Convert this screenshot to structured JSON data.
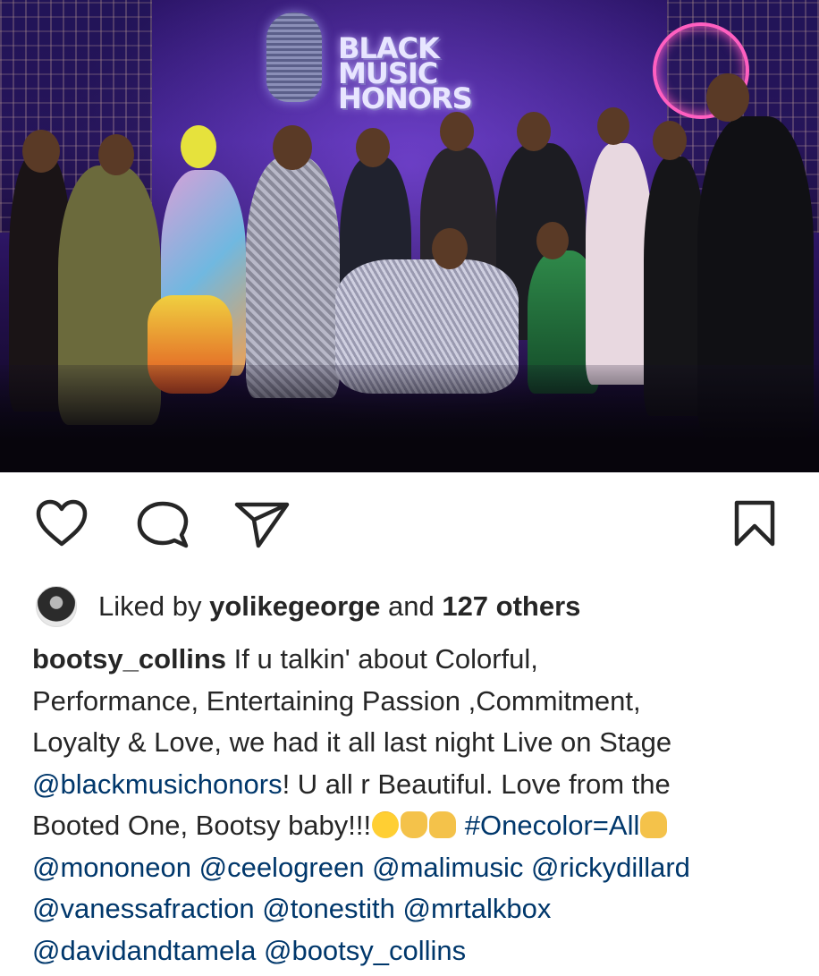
{
  "post": {
    "photo": {
      "stage_logo_lines": [
        "BLACK",
        "MUSIC",
        "HONORS"
      ]
    },
    "actions": {
      "like": "heart-icon",
      "comment": "comment-icon",
      "share": "share-icon",
      "save": "bookmark-icon"
    },
    "likes": {
      "prefix": "Liked by",
      "user": "yolikegeorge",
      "connector": "and",
      "others": "127 others"
    },
    "caption": {
      "username": "bootsy_collins",
      "line1_text": "If u talkin' about Colorful,",
      "line2_text": "Performance, Entertaining Passion ,Commitment,",
      "line3_text": "Loyalty & Love, we had it all last night Live on Stage",
      "line4_mention": "@blackmusichonors",
      "line4_text": "! U all r Beautiful. Love from the",
      "line5_text": "Booted One, Bootsy baby!!!",
      "line5_hashtag": "#Onecolor=All",
      "mentions_line6": [
        "@mononeon",
        "@ceelogreen",
        "@malimusic",
        "@rickydillard"
      ],
      "mentions_line7": [
        "@vanessafraction",
        "@tonestith",
        "@mrtalkbox"
      ],
      "mentions_line8": [
        "@davidandtamela",
        "@bootsy_collins"
      ]
    },
    "emoji_icons": [
      "star-struck-emoji",
      "folded-hands-emoji",
      "love-you-gesture-emoji"
    ]
  }
}
